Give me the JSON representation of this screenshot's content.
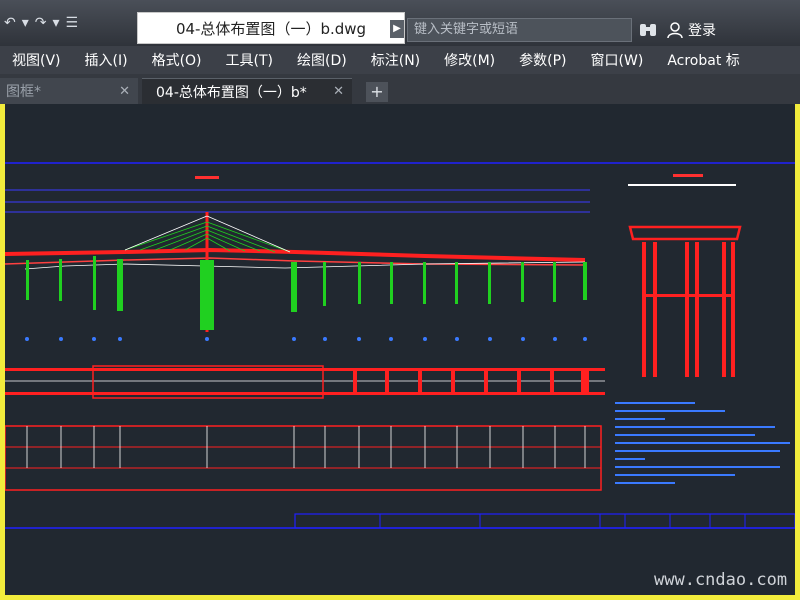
{
  "window": {
    "title": "04-总体布置图（一）b.dwg",
    "search_placeholder": "键入关键字或短语",
    "login_label": "登录"
  },
  "menu": [
    {
      "label": "视图(V)"
    },
    {
      "label": "插入(I)"
    },
    {
      "label": "格式(O)"
    },
    {
      "label": "工具(T)"
    },
    {
      "label": "绘图(D)"
    },
    {
      "label": "标注(N)"
    },
    {
      "label": "修改(M)"
    },
    {
      "label": "参数(P)"
    },
    {
      "label": "窗口(W)"
    },
    {
      "label": "Acrobat 标"
    }
  ],
  "tabs": [
    {
      "label": "图框*"
    },
    {
      "label": "04-总体布置图（一）b*"
    }
  ],
  "watermark": "www.cndao.com",
  "colors": {
    "canvas": "#212830",
    "frame": "#2020ff",
    "deck": "#ff2020",
    "pier": "#20d020",
    "frame_border": "#f2ec3c"
  }
}
